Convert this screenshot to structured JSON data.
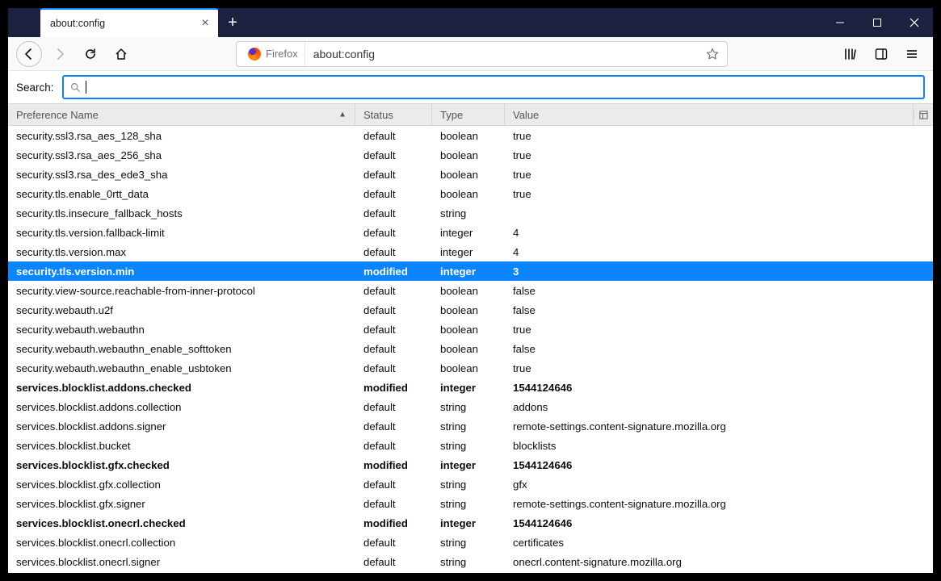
{
  "tab": {
    "title": "about:config"
  },
  "urlbar": {
    "identity": "Firefox",
    "url": "about:config"
  },
  "search": {
    "label": "Search:",
    "value": ""
  },
  "columns": {
    "name": "Preference Name",
    "status": "Status",
    "type": "Type",
    "value": "Value"
  },
  "rows": [
    {
      "name": "security.ssl3.rsa_aes_128_sha",
      "status": "default",
      "type": "boolean",
      "value": "true",
      "modified": false,
      "selected": false
    },
    {
      "name": "security.ssl3.rsa_aes_256_sha",
      "status": "default",
      "type": "boolean",
      "value": "true",
      "modified": false,
      "selected": false
    },
    {
      "name": "security.ssl3.rsa_des_ede3_sha",
      "status": "default",
      "type": "boolean",
      "value": "true",
      "modified": false,
      "selected": false
    },
    {
      "name": "security.tls.enable_0rtt_data",
      "status": "default",
      "type": "boolean",
      "value": "true",
      "modified": false,
      "selected": false
    },
    {
      "name": "security.tls.insecure_fallback_hosts",
      "status": "default",
      "type": "string",
      "value": "",
      "modified": false,
      "selected": false
    },
    {
      "name": "security.tls.version.fallback-limit",
      "status": "default",
      "type": "integer",
      "value": "4",
      "modified": false,
      "selected": false
    },
    {
      "name": "security.tls.version.max",
      "status": "default",
      "type": "integer",
      "value": "4",
      "modified": false,
      "selected": false
    },
    {
      "name": "security.tls.version.min",
      "status": "modified",
      "type": "integer",
      "value": "3",
      "modified": true,
      "selected": true
    },
    {
      "name": "security.view-source.reachable-from-inner-protocol",
      "status": "default",
      "type": "boolean",
      "value": "false",
      "modified": false,
      "selected": false
    },
    {
      "name": "security.webauth.u2f",
      "status": "default",
      "type": "boolean",
      "value": "false",
      "modified": false,
      "selected": false
    },
    {
      "name": "security.webauth.webauthn",
      "status": "default",
      "type": "boolean",
      "value": "true",
      "modified": false,
      "selected": false
    },
    {
      "name": "security.webauth.webauthn_enable_softtoken",
      "status": "default",
      "type": "boolean",
      "value": "false",
      "modified": false,
      "selected": false
    },
    {
      "name": "security.webauth.webauthn_enable_usbtoken",
      "status": "default",
      "type": "boolean",
      "value": "true",
      "modified": false,
      "selected": false
    },
    {
      "name": "services.blocklist.addons.checked",
      "status": "modified",
      "type": "integer",
      "value": "1544124646",
      "modified": true,
      "selected": false
    },
    {
      "name": "services.blocklist.addons.collection",
      "status": "default",
      "type": "string",
      "value": "addons",
      "modified": false,
      "selected": false
    },
    {
      "name": "services.blocklist.addons.signer",
      "status": "default",
      "type": "string",
      "value": "remote-settings.content-signature.mozilla.org",
      "modified": false,
      "selected": false
    },
    {
      "name": "services.blocklist.bucket",
      "status": "default",
      "type": "string",
      "value": "blocklists",
      "modified": false,
      "selected": false
    },
    {
      "name": "services.blocklist.gfx.checked",
      "status": "modified",
      "type": "integer",
      "value": "1544124646",
      "modified": true,
      "selected": false
    },
    {
      "name": "services.blocklist.gfx.collection",
      "status": "default",
      "type": "string",
      "value": "gfx",
      "modified": false,
      "selected": false
    },
    {
      "name": "services.blocklist.gfx.signer",
      "status": "default",
      "type": "string",
      "value": "remote-settings.content-signature.mozilla.org",
      "modified": false,
      "selected": false
    },
    {
      "name": "services.blocklist.onecrl.checked",
      "status": "modified",
      "type": "integer",
      "value": "1544124646",
      "modified": true,
      "selected": false
    },
    {
      "name": "services.blocklist.onecrl.collection",
      "status": "default",
      "type": "string",
      "value": "certificates",
      "modified": false,
      "selected": false
    },
    {
      "name": "services.blocklist.onecrl.signer",
      "status": "default",
      "type": "string",
      "value": "onecrl.content-signature.mozilla.org",
      "modified": false,
      "selected": false
    }
  ]
}
